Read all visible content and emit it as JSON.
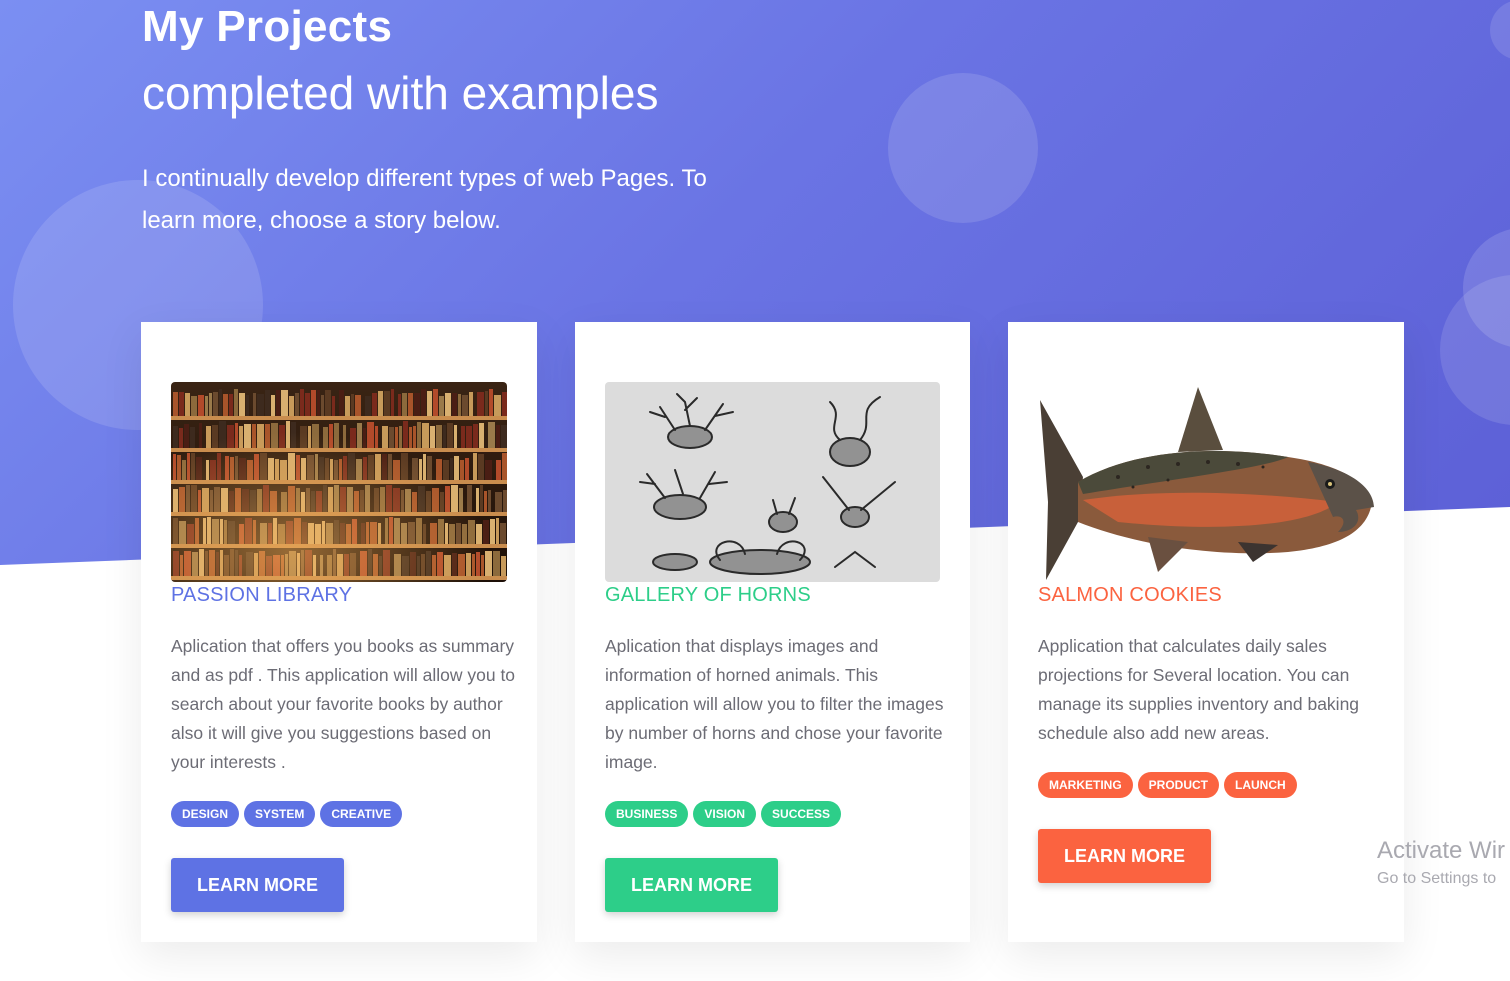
{
  "hero": {
    "title": "My Projects",
    "subtitle": "completed with examples",
    "description": "I continually develop different types of web Pages. To learn more, choose a story below."
  },
  "cards": [
    {
      "title": "PASSION LIBRARY",
      "description": "Aplication that offers you books as summary and as pdf . This application will allow you to search about your favorite books by author also it will give you suggestions based on your interests .",
      "tags": [
        "DESIGN",
        "SYSTEM",
        "CREATIVE"
      ],
      "button": "LEARN MORE",
      "color": "#5e72e4",
      "image": "bookshelf-photo"
    },
    {
      "title": "GALLERY OF HORNS",
      "description": "Aplication that displays images and information of horned animals. This application will allow you to filter the images by number of horns and chose your favorite image.",
      "tags": [
        "BUSINESS",
        "VISION",
        "SUCCESS"
      ],
      "button": "LEARN MORE",
      "color": "#2dce89",
      "image": "horned-animals-sketch"
    },
    {
      "title": "SALMON COOKIES",
      "description": "Application that calculates daily sales projections for Several location. You can manage its supplies inventory and baking schedule also add new areas.",
      "tags": [
        "MARKETING",
        "PRODUCT",
        "LAUNCH"
      ],
      "button": "LEARN MORE",
      "color": "#fb6340",
      "image": "salmon-illustration"
    }
  ],
  "watermark": {
    "line1": "Activate Wir",
    "line2": "Go to Settings to"
  }
}
